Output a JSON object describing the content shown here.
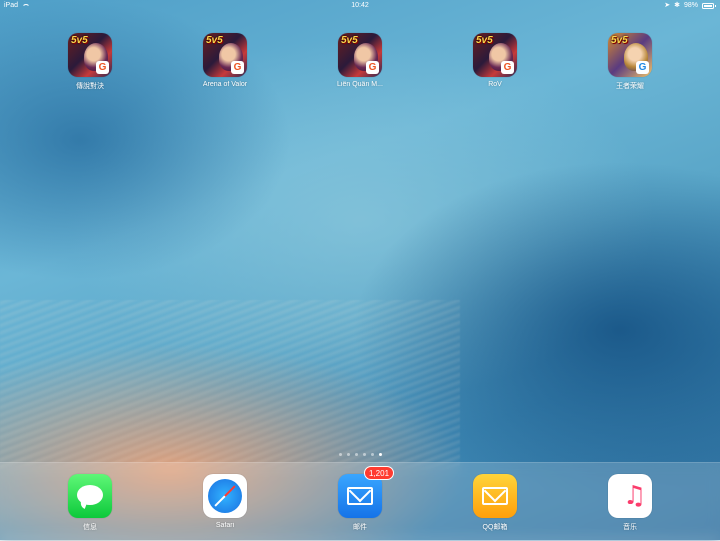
{
  "status_bar": {
    "device": "iPad",
    "time": "10:42",
    "battery": "98%",
    "battery_level": 0.98,
    "icons": [
      "wifi-icon",
      "location-icon",
      "bluetooth-icon",
      "battery-icon"
    ]
  },
  "home_apps": [
    {
      "label": "傳說對決",
      "icon": "arena-of-valor-game-icon"
    },
    {
      "label": "Arena of Valor",
      "icon": "arena-of-valor-game-icon"
    },
    {
      "label": "Liên Quân M...",
      "icon": "arena-of-valor-game-icon"
    },
    {
      "label": "RoV",
      "icon": "arena-of-valor-game-icon"
    },
    {
      "label": "王者荣耀",
      "icon": "honor-of-kings-game-icon"
    }
  ],
  "game_icon_text": "5v5",
  "page_dots": {
    "count": 6,
    "active_index": 5
  },
  "dock": [
    {
      "label": "信息",
      "icon": "messages-icon"
    },
    {
      "label": "Safari",
      "icon": "safari-icon"
    },
    {
      "label": "邮件",
      "icon": "mail-icon",
      "badge": "1,201"
    },
    {
      "label": "QQ邮箱",
      "icon": "qq-mail-icon"
    },
    {
      "label": "音乐",
      "icon": "music-icon"
    }
  ],
  "colors": {
    "badge": "#ff3b30",
    "messages_green": "#0cc93b",
    "mail_blue": "#1573e8",
    "qqmail_yellow": "#ffd43a",
    "music_pink": "#fb3c6c"
  }
}
